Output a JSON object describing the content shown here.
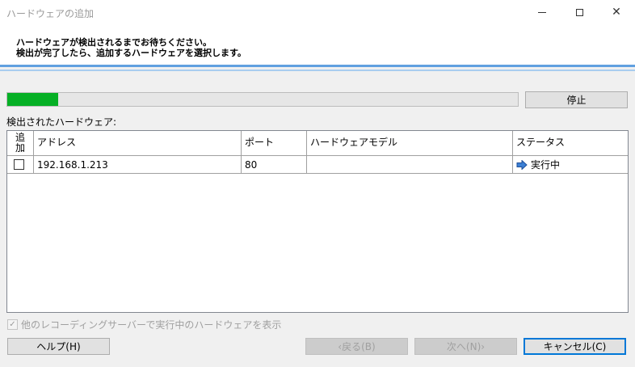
{
  "window": {
    "title": "ハードウェアの追加",
    "minimize_icon": "minimize-icon",
    "maximize_icon": "maximize-icon",
    "close_glyph": "✕"
  },
  "header": {
    "line1": "ハードウェアが検出されるまでお待ちください。",
    "line2": "検出が完了したら、追加するハードウェアを選択します。"
  },
  "progress": {
    "value": 0.1
  },
  "stop_button": "停止",
  "detected_label": "検出されたハードウェア:",
  "table": {
    "headers": {
      "add_line1": "追",
      "add_line2": "加",
      "address": "アドレス",
      "port": "ポート",
      "model": "ハードウェアモデル",
      "status": "ステータス"
    },
    "rows": [
      {
        "checked": false,
        "address": "192.168.1.213",
        "port": "80",
        "model": "",
        "status": "実行中",
        "status_icon": "arrow-right-icon"
      }
    ]
  },
  "show_other": {
    "checked": true,
    "label": "他のレコーディングサーバーで実行中のハードウェアを表示"
  },
  "footer": {
    "help": "ヘルプ(H)",
    "back": "‹戻る(B)",
    "next": "次へ(N)›",
    "cancel": "キャンセル(C)"
  },
  "colors": {
    "accent": "#0078d7",
    "progress": "#06b025",
    "separator": "#61a0e0"
  }
}
